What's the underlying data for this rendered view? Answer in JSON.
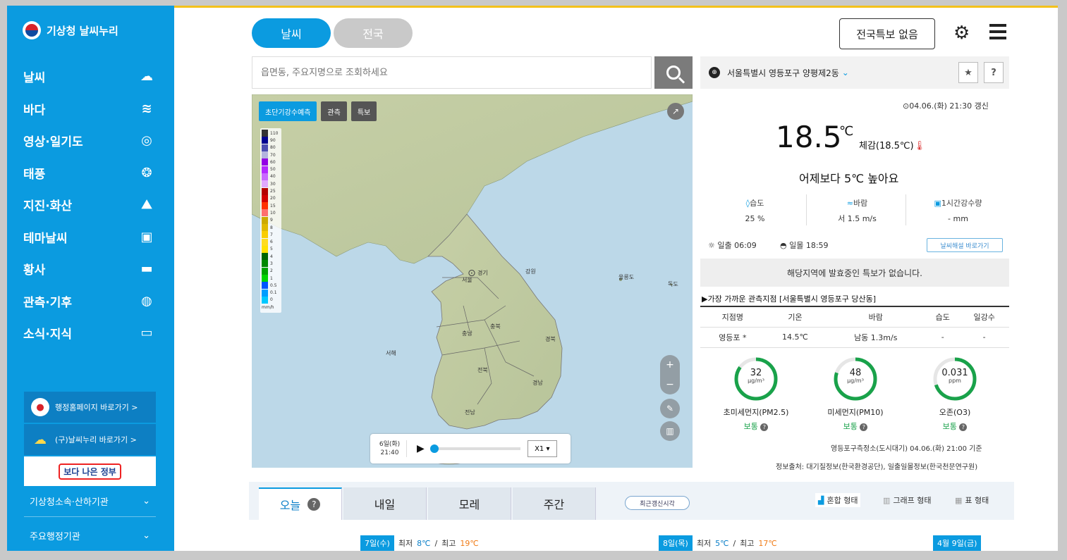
{
  "sidebar": {
    "logo": "기상청 날씨누리",
    "items": [
      {
        "label": "날씨",
        "icon": "cloud-sun-icon",
        "glyph": "☁"
      },
      {
        "label": "바다",
        "icon": "wave-icon",
        "glyph": "≋"
      },
      {
        "label": "영상·일기도",
        "icon": "satellite-icon",
        "glyph": "◎"
      },
      {
        "label": "태풍",
        "icon": "typhoon-icon",
        "glyph": "❂"
      },
      {
        "label": "지진·화산",
        "icon": "earthquake-icon",
        "glyph": "⛰"
      },
      {
        "label": "테마날씨",
        "icon": "suitcase-icon",
        "glyph": "▣"
      },
      {
        "label": "황사",
        "icon": "dust-icon",
        "glyph": "▬"
      },
      {
        "label": "관측·기후",
        "icon": "globe-icon",
        "glyph": "◍"
      },
      {
        "label": "소식·지식",
        "icon": "play-icon",
        "glyph": "▭"
      }
    ],
    "link_admin": "행정홈페이지 바로가기 >",
    "link_old": "(구)날씨누리 바로가기 >",
    "gov_banner": "보다 나은 정부",
    "affiliates": "기상청소속·산하기관",
    "agencies": "주요행정기관"
  },
  "header": {
    "tab_weather": "날씨",
    "tab_national": "전국",
    "alert_button": "전국특보 없음"
  },
  "search": {
    "placeholder": "읍면동, 주요지명으로 조회하세요"
  },
  "map": {
    "tabs": [
      "초단기강수예측",
      "관측",
      "특보"
    ],
    "legend_values": [
      "110",
      "90",
      "80",
      "70",
      "60",
      "50",
      "40",
      "30",
      "25",
      "20",
      "15",
      "10",
      "9",
      "8",
      "7",
      "6",
      "5",
      "4",
      "3",
      "2",
      "1",
      "0.5",
      "0.1",
      "0"
    ],
    "legend_colors": [
      "#333333",
      "#000390",
      "#4c4eb1",
      "#b3b4de",
      "#9300e4",
      "#b329ff",
      "#c969ff",
      "#e0a9ff",
      "#b40000",
      "#d20000",
      "#ff3200",
      "#ff6e6e",
      "#ccaa00",
      "#e0b900",
      "#f9cd00",
      "#ffdc1f",
      "#ffe100",
      "#006600",
      "#008800",
      "#00a300",
      "#00d500",
      "#0055ff",
      "#009dff",
      "#00c8ff"
    ],
    "legend_unit": "mm/h",
    "player_date": "6일(화)",
    "player_time": "21:40",
    "speed": "X1 ▾",
    "place_labels": [
      "경기",
      "강원",
      "충남",
      "충북",
      "경북",
      "전북",
      "경남",
      "전남",
      "서해",
      "울릉도",
      "독도",
      "서울"
    ]
  },
  "current": {
    "location": "서울특별시 영등포구 양평제2동",
    "updated": "04.06.(화) 21:30 갱신",
    "temperature": "18.5",
    "temp_unit": "℃",
    "feels_like": "체감(18.5℃)",
    "compare": "어제보다 5℃ 높아요",
    "humidity_label": "습도",
    "humidity_value": "25 %",
    "wind_label": "바람",
    "wind_value": "서 1.5 m/s",
    "rain_label": "1시간강수량",
    "rain_value": "- mm",
    "sunrise": "일출 06:09",
    "sunset": "일몰 18:59",
    "guide_button": "날씨해설 바로가기",
    "notice": "해당지역에 발효중인 특보가 없습니다."
  },
  "observation": {
    "title": "▶가장 가까운 관측지점 [서울특별시 영등포구 당산동]",
    "headers": [
      "지점명",
      "기온",
      "바람",
      "습도",
      "일강수"
    ],
    "row": [
      "영등포 *",
      "14.5℃",
      "남동 1.3m/s",
      "-",
      "-"
    ]
  },
  "air_quality": [
    {
      "value": "32",
      "unit": "μg/m³",
      "name": "초미세먼지(PM2.5)",
      "status": "보통",
      "level": 0.85
    },
    {
      "value": "48",
      "unit": "μg/m³",
      "name": "미세먼지(PM10)",
      "status": "보통",
      "level": 0.8
    },
    {
      "value": "0.031",
      "unit": "ppm",
      "name": "오존(O3)",
      "status": "보통",
      "level": 0.7
    }
  ],
  "aq_station": "영등포구측정소(도시대기) 04.06.(화) 21:00 기준",
  "source": "정보출처: 대기질정보(한국환경공단), 일출일몰정보(한국천문연구원)",
  "forecast_tabs": [
    "오늘",
    "내일",
    "모레",
    "주간"
  ],
  "recent_button": "최근갱신시각",
  "views": [
    "혼합 형태",
    "그래프 형태",
    "표 형태"
  ],
  "forecast_days": [
    {
      "date": "7일(수)",
      "min_label": "최저",
      "min": "8℃",
      "max_label": "최고",
      "max": "19℃"
    },
    {
      "date": "8일(목)",
      "min_label": "최저",
      "min": "5℃",
      "max_label": "최고",
      "max": "17℃"
    },
    {
      "date": "4월 9일(금)"
    }
  ],
  "colors": {
    "brand": "#0b9be0",
    "accent": "#f3c11b",
    "good": "#19a24a"
  }
}
